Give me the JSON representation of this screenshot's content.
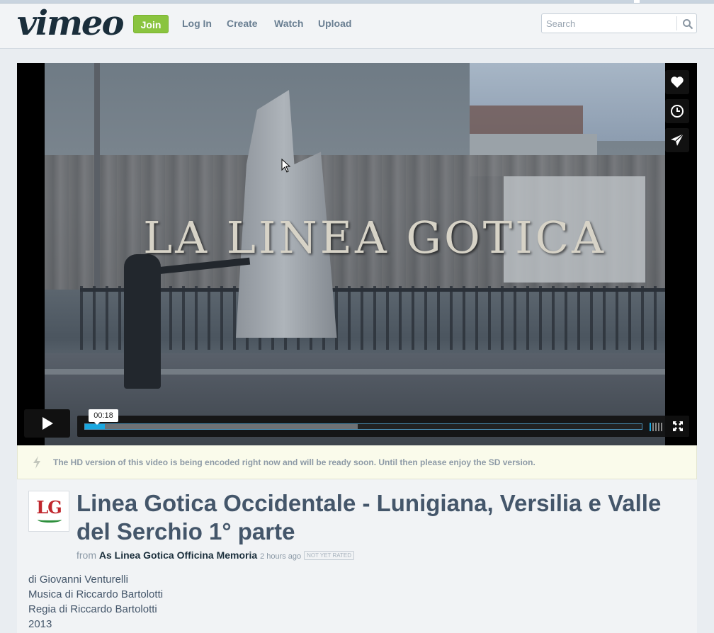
{
  "header": {
    "logo": "vimeo",
    "join_label": "Join",
    "nav": [
      "Log In",
      "Create",
      "Watch",
      "Upload"
    ],
    "search_placeholder": "Search"
  },
  "player": {
    "overlay_title": "LA LINEA GOTICA",
    "time_tooltip": "00:18",
    "progress": {
      "played_fraction": 0.035,
      "loaded_fraction": 0.49
    },
    "side_buttons": [
      "heart-icon",
      "clock-icon",
      "paper-plane-icon"
    ],
    "accent_color": "#1aa8e0"
  },
  "notice": {
    "text": "The HD version of this video is being encoded right now and will be ready soon. Until then please enjoy the SD version."
  },
  "video": {
    "avatar_text": "LG",
    "title": "Linea Gotica Occidentale - Lunigiana, Versilia e Valle del Serchio 1° parte",
    "from_label": "from",
    "author": "As Linea Gotica Officina Memoria",
    "posted": "2 hours ago",
    "rating_badge": "NOT YET RATED",
    "description": [
      "di Giovanni Venturelli",
      "Musica di Riccardo Bartolotti",
      "Regia di Riccardo Bartolotti",
      "2013"
    ]
  },
  "colors": {
    "join_green": "#8ac43f",
    "title_color": "#44566a"
  }
}
